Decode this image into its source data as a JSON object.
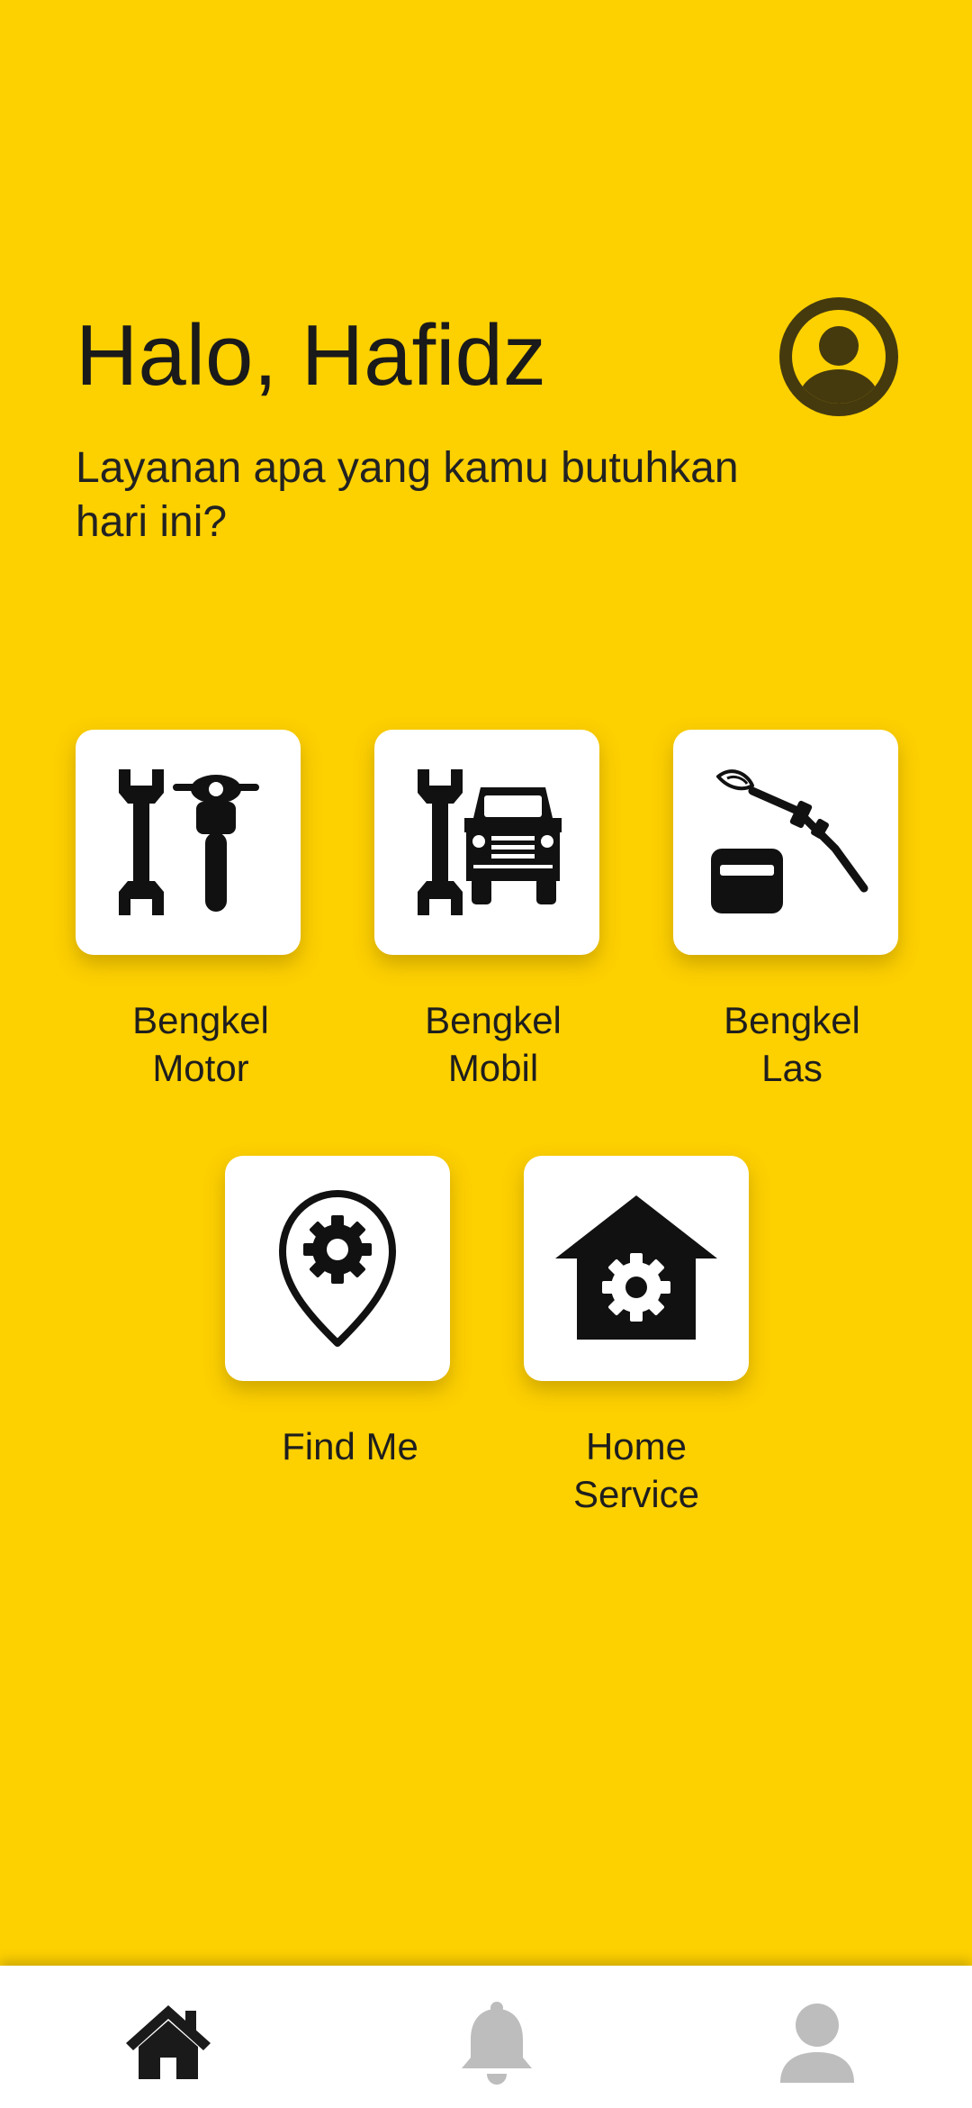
{
  "header": {
    "greeting": "Halo, Hafidz",
    "subtitle": "Layanan apa yang kamu butuhkan hari ini?"
  },
  "profile_avatar_icon": "user-circle-icon",
  "services": [
    {
      "label": "Bengkel\nMotor",
      "icon": "wrench-motorcycle-icon"
    },
    {
      "label": "Bengkel\nMobil",
      "icon": "wrench-car-icon"
    },
    {
      "label": "Bengkel\nLas",
      "icon": "welding-torch-icon"
    },
    {
      "label": "Find Me",
      "icon": "location-gear-icon"
    },
    {
      "label": "Home\nService",
      "icon": "house-gear-icon"
    }
  ],
  "bottom_nav": [
    {
      "icon": "home-icon",
      "active": true
    },
    {
      "icon": "bell-icon",
      "active": false
    },
    {
      "icon": "profile-icon",
      "active": false
    }
  ],
  "colors": {
    "background": "#FDD000",
    "avatar": "#453A0E",
    "tile": "#FFFFFF",
    "nav_active": "#1A1A1A",
    "nav_inactive": "#BDBDBD"
  }
}
